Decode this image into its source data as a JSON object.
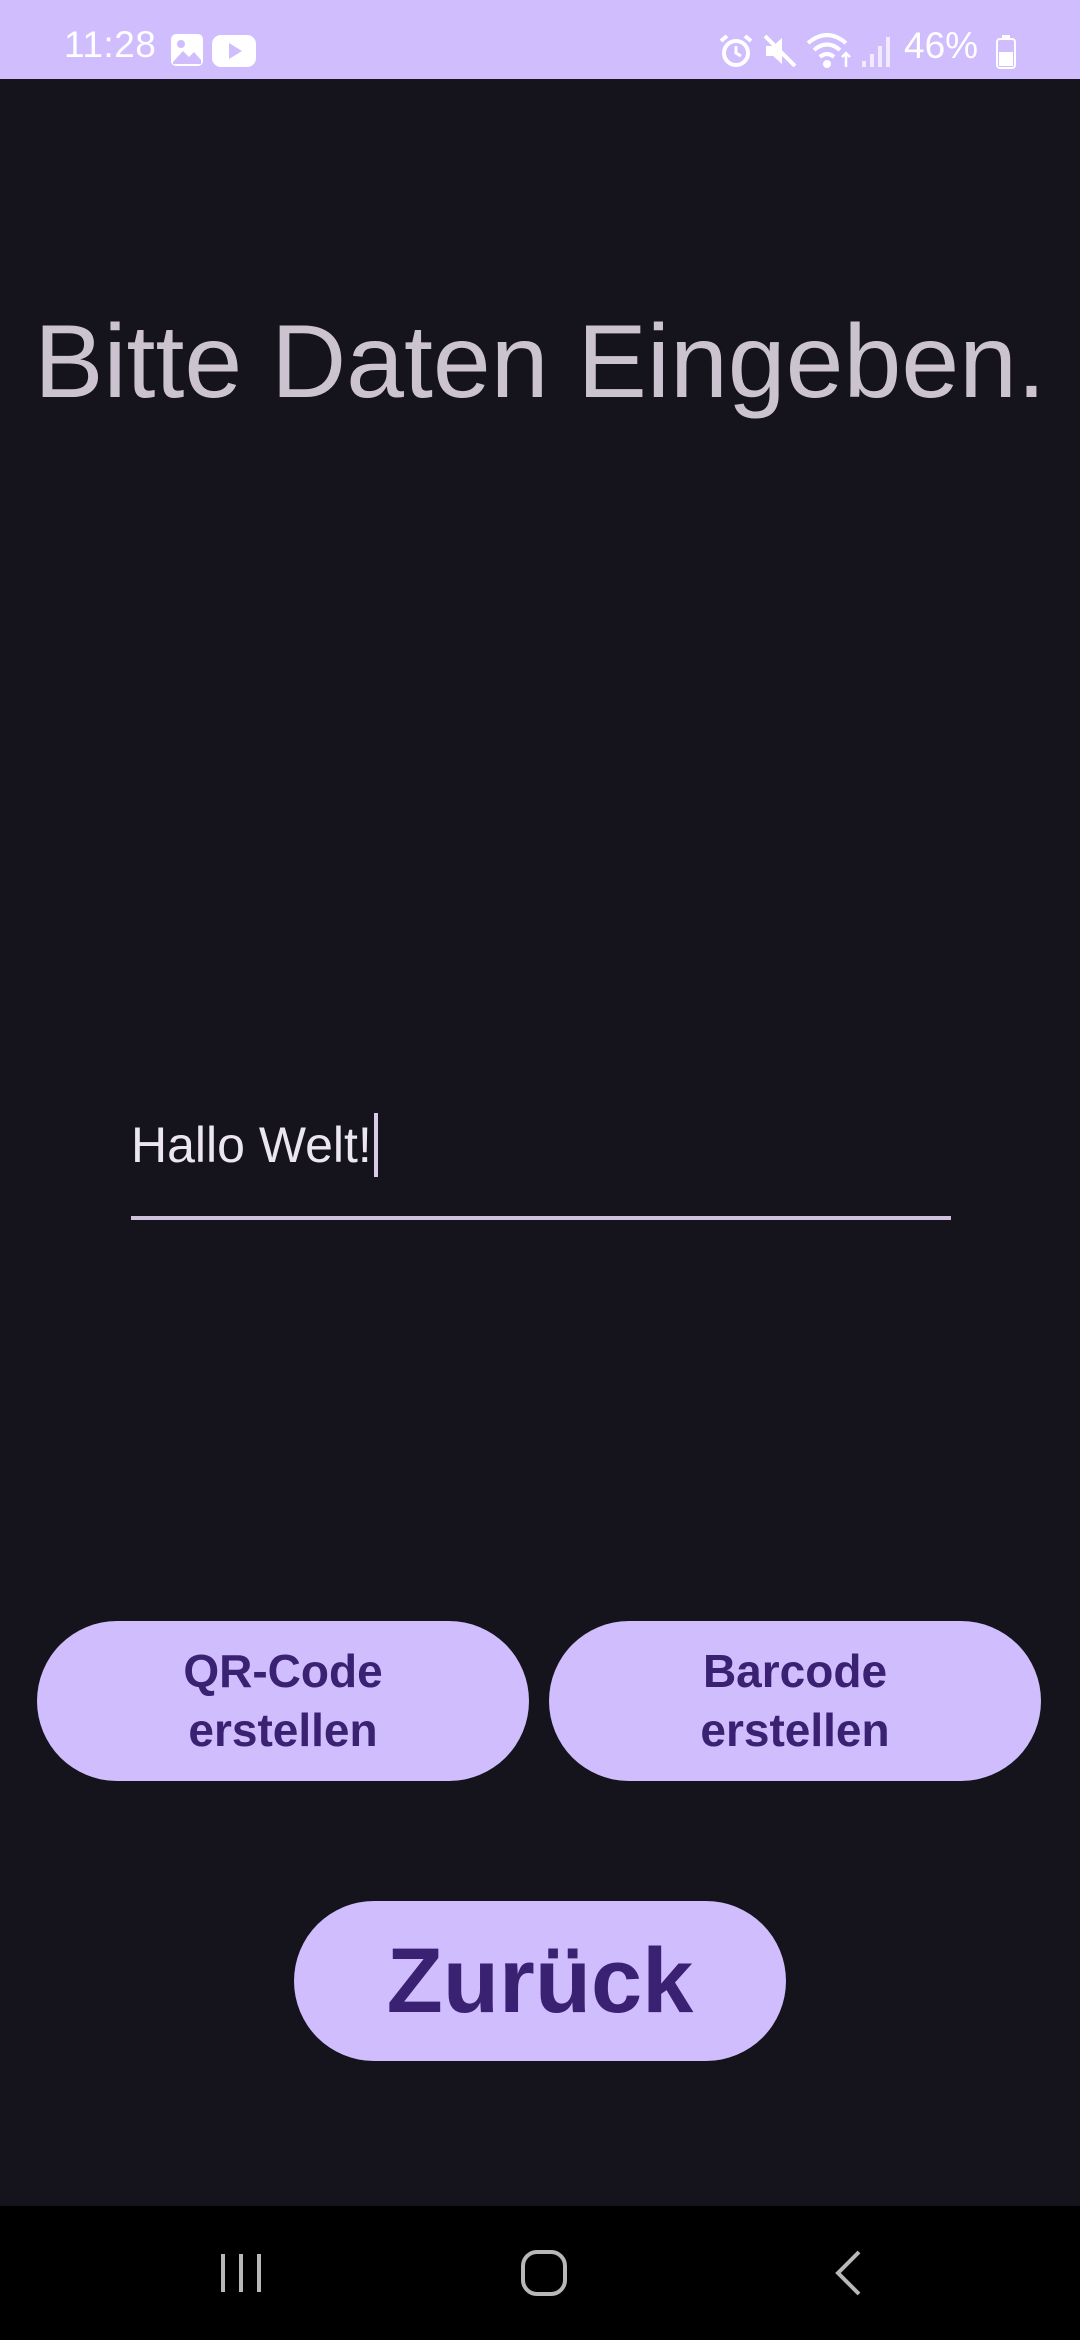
{
  "status_bar": {
    "time": "11:28",
    "battery": "46%",
    "icons": [
      "image-icon",
      "youtube-icon",
      "alarm-icon",
      "mute-icon",
      "wifi-icon",
      "signal-icon",
      "battery-icon"
    ]
  },
  "main": {
    "title": "Bitte Daten Eingeben.",
    "input_value": "Hallo Welt!"
  },
  "buttons": {
    "qr_line1": "QR-Code",
    "qr_line2": "erstellen",
    "barcode_line1": "Barcode",
    "barcode_line2": "erstellen",
    "back": "Zurück"
  },
  "nav_bar": {
    "icons": [
      "recent-apps-icon",
      "home-icon",
      "back-icon"
    ]
  },
  "colors": {
    "accent": "#cfbdfe",
    "background": "#15131b",
    "button_text": "#3a2172"
  }
}
